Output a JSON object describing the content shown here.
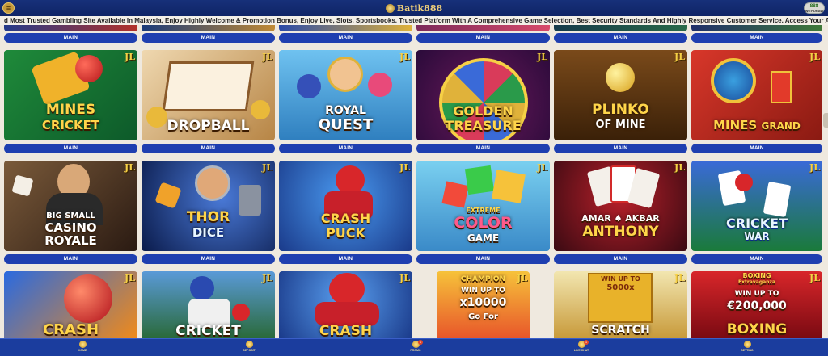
{
  "header": {
    "logo": "Batik888",
    "balance_amount": "888",
    "balance_sub": "WITHDRAW"
  },
  "ticker": "d Most Trusted Gambling Site Available In Malaysia, Enjoy Highly Welcome & Promotion Bonus, Enjoy Live, Slots, Sportsbooks. Trusted Platform With A Comprehensive Game Selection, Best Security Standards And Highly Responsive Customer Service. Access Your Account, And",
  "button_label": "MAIN",
  "provider_badge": "JL",
  "games": [
    {
      "title": "MINES CRICKET"
    },
    {
      "title": "DROPBALL"
    },
    {
      "title": "ROYAL QUEST"
    },
    {
      "title": "GOLDEN TREASURE"
    },
    {
      "title": "PLINKO OF MINE"
    },
    {
      "title": "MINES GRAND"
    },
    {
      "title": "BIG SMALL CASINO ROYALE"
    },
    {
      "title": "THOR DICE"
    },
    {
      "title": "CRASH PUCK"
    },
    {
      "title": "EXTREME COLOR GAME"
    },
    {
      "title": "AMAR AKBAR ANTHONY"
    },
    {
      "title": "CRICKET WAR"
    },
    {
      "title": "CRASH"
    },
    {
      "title": "CRICKET"
    },
    {
      "title": "CRASH"
    },
    {
      "title": "CHAMPION WIN UP TO x10000 Go For"
    },
    {
      "title": "WIN UP TO 5000x SCRATCH"
    },
    {
      "title": "BOXING Extravaganza WIN UP TO €200,000 BOXING"
    }
  ],
  "text": {
    "g0a": "MINES",
    "g0b": "CRICKET",
    "g1": "DROPBALL",
    "g2a": "ROYAL",
    "g2b": "QUEST",
    "g3a": "GOLDEN",
    "g3b": "TREASURE",
    "g4a": "PLINKO",
    "g4b": "OF MINE",
    "g5a": "MINES",
    "g5b": "GRAND",
    "g6a": "BIG SMALL",
    "g6b": "CASINO",
    "g6c": "ROYALE",
    "g7a": "THOR",
    "g7b": "DICE",
    "g8a": "CRASH",
    "g8b": "PUCK",
    "g9a": "EXTREME",
    "g9b": "COLOR",
    "g9c": "GAME",
    "g10a": "AMAR",
    "g10b": "AKBAR",
    "g10c": "ANTHONY",
    "g11a": "CRICKET",
    "g11b": "WAR",
    "g12": "CRASH",
    "g13": "CRICKET",
    "g14": "CRASH",
    "g15a": "CHAMPION",
    "g15b": "WIN UP TO",
    "g15c": "x10000",
    "g15d": "Go For",
    "g16a": "WIN UP TO",
    "g16b": "5000x",
    "g16c": "SCRATCH",
    "g17a": "BOXING",
    "g17b": "Extravaganza",
    "g17c": "WIN UP TO",
    "g17d": "€200,000",
    "g17e": "BOXING"
  },
  "bottom_nav": [
    {
      "label": "HOME",
      "icon": "home-icon"
    },
    {
      "label": "DEPOSIT",
      "icon": "deposit-icon"
    },
    {
      "label": "PROMO",
      "icon": "promo-icon",
      "badge": "1"
    },
    {
      "label": "LIVE CHAT",
      "icon": "chat-icon",
      "badge": "1"
    },
    {
      "label": "SETTING",
      "icon": "setting-icon"
    }
  ],
  "colors": {
    "header_bg": "#17307a",
    "button_bg": "#1f3fb0",
    "nav_bg": "#1b3d9e",
    "page_bg": "#efe9df",
    "accent_gold": "#f6d045"
  }
}
